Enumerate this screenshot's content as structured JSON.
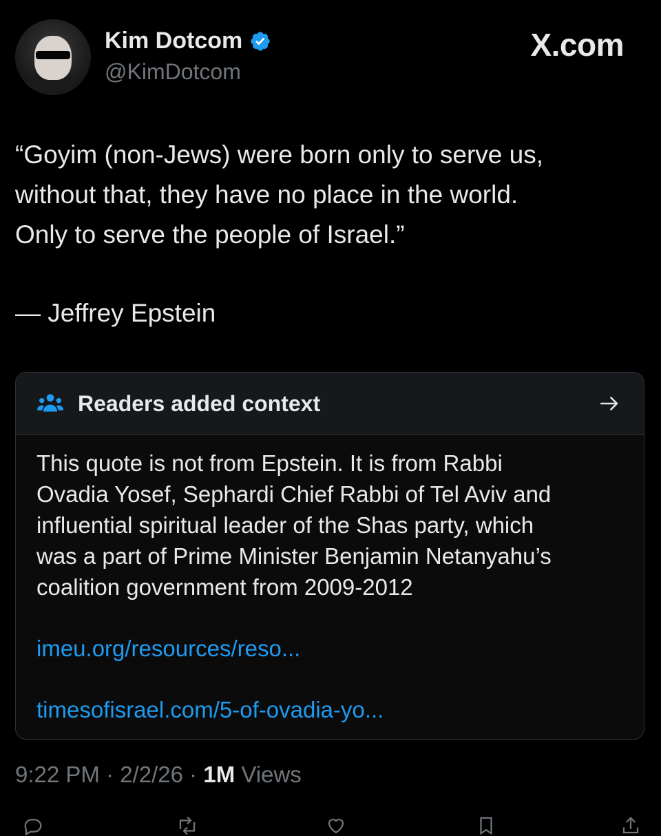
{
  "author": {
    "name": "Kim Dotcom",
    "handle": "@KimDotcom"
  },
  "brand": "X.com",
  "tweet": {
    "quote_lines": [
      "“Goyim (non-Jews) were born only to serve us,",
      "without that, they have no place in the world.",
      "Only to serve the people of Israel.”"
    ],
    "attribution": "— Jeffrey Epstein"
  },
  "community_note": {
    "title": "Readers added context",
    "body_lines": [
      "This quote is not from Epstein. It is from Rabbi",
      "Ovadia Yosef, Sephardi Chief Rabbi of Tel Aviv and",
      "influential spiritual leader of the Shas party, which",
      "was a part of Prime Minister Benjamin Netanyahu’s",
      "coalition government from 2009-2012"
    ],
    "links": [
      "imeu.org/resources/reso...",
      "timesofisrael.com/5-of-ovadia-yo..."
    ]
  },
  "meta": {
    "time": "9:22 PM",
    "date": "2/2/26",
    "separator": "·",
    "views_count": "1M",
    "views_label": "Views"
  },
  "icons": {
    "verified": "verified-badge-icon",
    "people": "people-icon",
    "arrow": "arrow-right-icon"
  },
  "colors": {
    "background": "#000000",
    "text": "#e7e9ea",
    "muted": "#71767b",
    "link": "#1d9bf0",
    "verified": "#1d9bf0"
  }
}
